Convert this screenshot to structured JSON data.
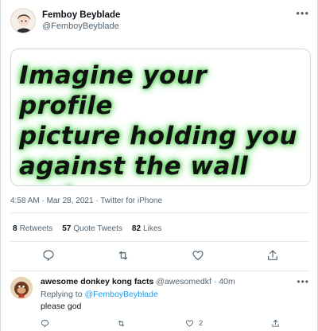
{
  "tweet": {
    "display_name": "Femboy Beyblade",
    "handle": "@FemboyBeyblade",
    "more_icon": "more-horizontal-icon",
    "image_text": "Imagine your profile\npicture holding you\nagainst the wall and\nslowly fucking you.",
    "timestamp": "4:58 AM · Mar 28, 2021 · Twitter for iPhone",
    "stats": {
      "retweets_count": "8",
      "retweets_label": "Retweets",
      "quote_count": "57",
      "quote_label": "Quote Tweets",
      "likes_count": "82",
      "likes_label": "Likes"
    },
    "actions": [
      "reply-icon",
      "retweet-icon",
      "like-icon",
      "share-icon"
    ]
  },
  "reply": {
    "display_name": "awesome donkey kong facts",
    "handle": "@awesomedkf",
    "separator": "·",
    "time": "40m",
    "replying_prefix": "Replying to",
    "replying_to": "@FemboyBeyblade",
    "text": "please god",
    "like_count": "2"
  },
  "colors": {
    "accent": "#1d9bf0",
    "glow": "#5fd05f",
    "muted": "#536471"
  }
}
